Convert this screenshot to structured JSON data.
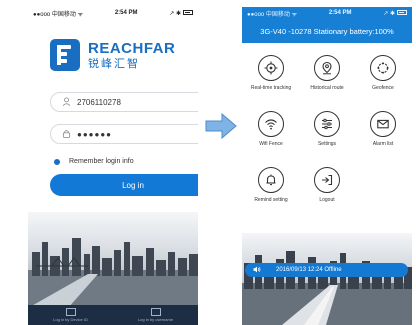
{
  "login": {
    "status": {
      "carrier": "●●ooo 中国移动 ᯤ",
      "time": "2:54 PM",
      "right": "↗ ✱"
    },
    "brand": {
      "name_en": "REACHFAR",
      "name_cn": "锐峰汇智"
    },
    "username_value": "2706110278",
    "password_value": "●●●●●●",
    "remember_label": "Remember login info",
    "login_button": "Log in",
    "tabs": [
      {
        "label": "Log in by Device ID",
        "icon": "list-icon"
      },
      {
        "label": "Log in by username",
        "icon": "id-card-icon"
      }
    ]
  },
  "menu": {
    "status": {
      "carrier": "●●ooo 中国移动 ᯤ",
      "time": "2:54 PM",
      "right": "↗ ✱"
    },
    "device_info": "3G-V40 -10278 Stationary battery:100%",
    "items": [
      {
        "label": "Real-time tracking",
        "icon": "crosshair-icon"
      },
      {
        "label": "Historical route",
        "icon": "location-pin-icon"
      },
      {
        "label": "Geofence",
        "icon": "geofence-icon"
      },
      {
        "label": "Wifi Fence",
        "icon": "wifi-icon"
      },
      {
        "label": "Settings",
        "icon": "sliders-icon"
      },
      {
        "label": "Alarm list",
        "icon": "envelope-icon"
      },
      {
        "label": "Remind setting",
        "icon": "bell-icon"
      },
      {
        "label": "Logout",
        "icon": "logout-icon"
      }
    ],
    "alarm_text": "2016/09/13 12:24 Offline"
  },
  "colors": {
    "primary": "#1479d3",
    "brand": "#1a6ec1",
    "tabbar": "#1c2d44",
    "arrow": "#7fb2e5"
  }
}
